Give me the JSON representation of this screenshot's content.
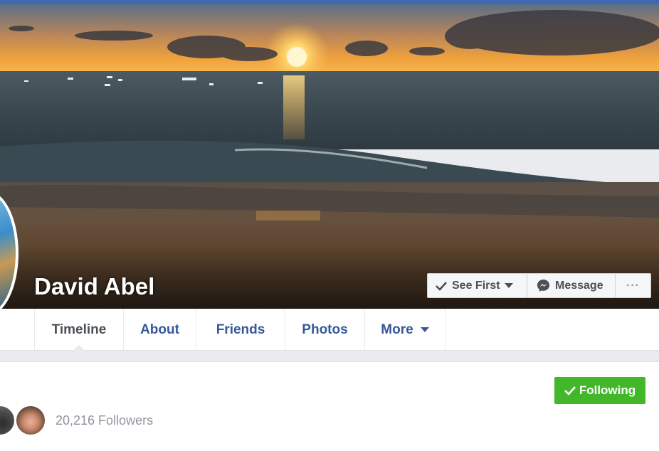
{
  "profile": {
    "name": "David Abel"
  },
  "actions": {
    "see_first_label": "See First",
    "message_label": "Message",
    "more_label": "···"
  },
  "nav": {
    "tabs": [
      {
        "label": "Timeline",
        "active": true
      },
      {
        "label": "About"
      },
      {
        "label": "Friends"
      },
      {
        "label": "Photos"
      },
      {
        "label": "More"
      }
    ]
  },
  "follow": {
    "button_label": "Following",
    "followers_text": "20,216 Followers"
  },
  "colors": {
    "brand_blue": "#4267b2",
    "link_blue": "#365899",
    "following_green": "#42b72a",
    "muted_text": "#90949c"
  },
  "icons": {
    "see_first": "checkmark-icon",
    "dropdown": "caret-down-icon",
    "message": "messenger-icon",
    "more": "ellipsis-icon",
    "following": "checkmark-icon"
  }
}
